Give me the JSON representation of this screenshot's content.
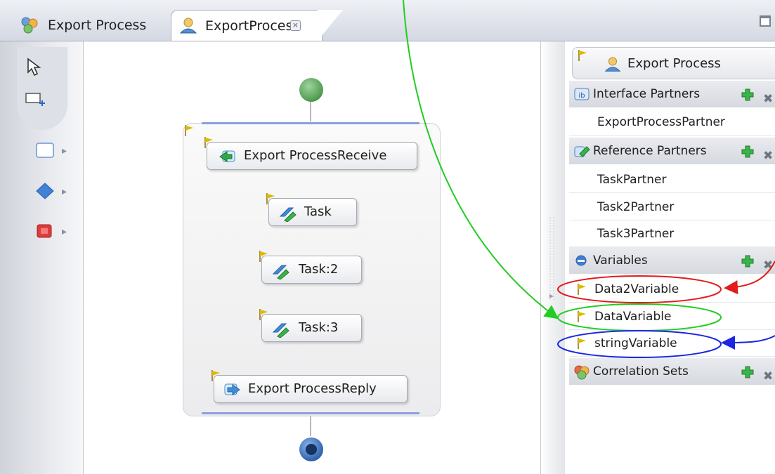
{
  "tabs": [
    {
      "label": "Export Process",
      "icon": "partner-link-icon"
    },
    {
      "label": "ExportProcess",
      "icon": "process-icon",
      "close": "×"
    }
  ],
  "palette": {
    "tools": [
      "select-arrow-icon",
      "marquee-icon"
    ],
    "items": [
      "container-icon",
      "decision-icon",
      "stop-icon"
    ]
  },
  "process": {
    "nodes": [
      {
        "label": "Export ProcessReceive",
        "icon": "receive-icon"
      },
      {
        "label": "Task",
        "icon": "invoke-icon"
      },
      {
        "label": "Task:2",
        "icon": "invoke-icon"
      },
      {
        "label": "Task:3",
        "icon": "invoke-icon"
      },
      {
        "label": "Export ProcessReply",
        "icon": "reply-icon"
      }
    ]
  },
  "outline": {
    "title": "Export Process",
    "sections": {
      "interface_partners": {
        "label": "Interface Partners",
        "items": [
          "ExportProcessPartner"
        ]
      },
      "reference_partners": {
        "label": "Reference Partners",
        "items": [
          "TaskPartner",
          "Task2Partner",
          "Task3Partner"
        ]
      },
      "variables": {
        "label": "Variables",
        "items": [
          "Data2Variable",
          "DataVariable",
          "stringVariable"
        ]
      },
      "correlation_sets": {
        "label": "Correlation Sets",
        "items": []
      }
    }
  },
  "annotations": {
    "colors": {
      "green": "#22cc22",
      "red": "#e21b1b",
      "blue": "#1b27e0"
    },
    "highlighted": [
      "Data2Variable",
      "DataVariable",
      "stringVariable"
    ]
  },
  "colors": {
    "start": "#5aa85a",
    "end": "#2c5fa8",
    "flow": "#8b32c8",
    "flag": "#e0b800"
  }
}
